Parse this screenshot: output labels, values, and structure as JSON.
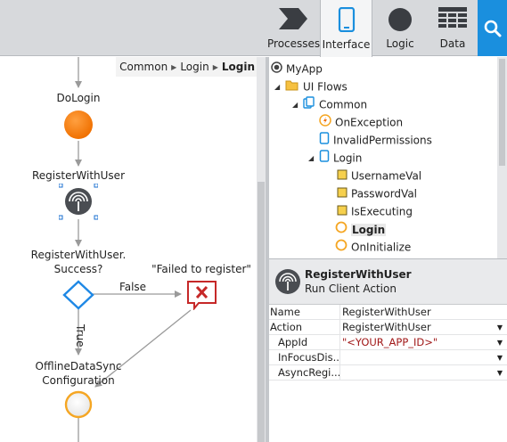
{
  "toolbar": {
    "tabs": [
      {
        "label": "Processes",
        "icon": "processes-icon"
      },
      {
        "label": "Interface",
        "icon": "interface-icon"
      },
      {
        "label": "Logic",
        "icon": "logic-icon"
      },
      {
        "label": "Data",
        "icon": "data-icon"
      }
    ],
    "active_tab": "Interface",
    "search_icon": "search-icon",
    "accent_color": "#1a8fde"
  },
  "breadcrumb": {
    "items": [
      "Common",
      "Login"
    ],
    "current": "Login"
  },
  "flow": {
    "nodes": {
      "dologin": "DoLogin",
      "register": "RegisterWithUser",
      "decision_line1": "RegisterWithUser.",
      "decision_line2": "Success?",
      "error": "\"Failed to register\"",
      "offline_line1": "OfflineDataSync",
      "offline_line2": "Configuration"
    },
    "edge_labels": {
      "false": "False",
      "true": "True"
    },
    "colors": {
      "start_node": "#f57c00",
      "decision": "#1e88e5",
      "error": "#c62828",
      "end_node": "#f5a623"
    }
  },
  "tree": {
    "items": [
      {
        "label": "MyApp",
        "icon": "app-icon"
      },
      {
        "label": "UI Flows",
        "icon": "folder-icon"
      },
      {
        "label": "Common",
        "icon": "flow-icon"
      },
      {
        "label": "OnException",
        "icon": "exception-handler-icon"
      },
      {
        "label": "InvalidPermissions",
        "icon": "screen-icon"
      },
      {
        "label": "Login",
        "icon": "screen-icon"
      },
      {
        "label": "UsernameVal",
        "icon": "variable-icon"
      },
      {
        "label": "PasswordVal",
        "icon": "variable-icon"
      },
      {
        "label": "IsExecuting",
        "icon": "variable-icon"
      },
      {
        "label": "Login",
        "icon": "client-action-icon"
      },
      {
        "label": "OnInitialize",
        "icon": "client-action-icon"
      }
    ],
    "selected": "Login"
  },
  "properties": {
    "header_title": "RegisterWithUser",
    "header_subtitle": "Run Client Action",
    "rows": [
      {
        "name": "Name",
        "value": "RegisterWithUser"
      },
      {
        "name": "Action",
        "value": "RegisterWithUser"
      },
      {
        "name": "AppId",
        "value": "\"<YOUR_APP_ID>\""
      },
      {
        "name": "InFocusDis...",
        "value": ""
      },
      {
        "name": "AsyncRegi...",
        "value": ""
      }
    ]
  }
}
